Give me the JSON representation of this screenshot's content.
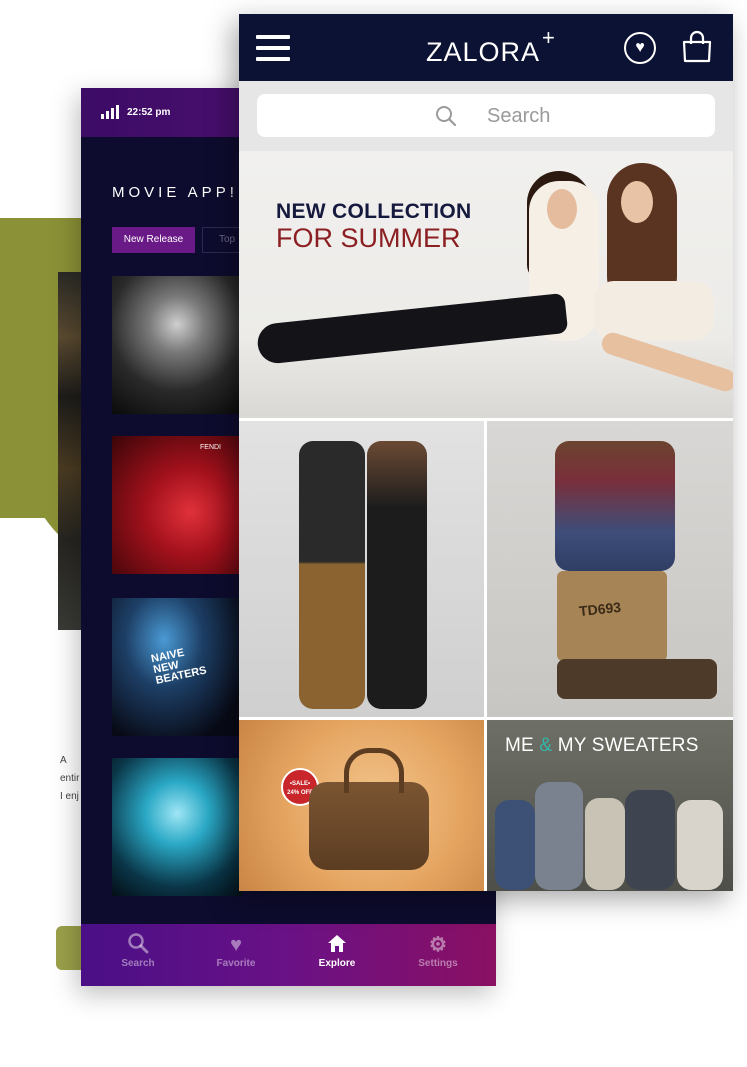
{
  "back_card": {
    "text_lines": [
      "A",
      "entir",
      "I enj"
    ]
  },
  "movie_app": {
    "status": {
      "time": "22:52 pm"
    },
    "title": "MOVIE APP!",
    "tabs": [
      {
        "label": "New Release",
        "active": true
      },
      {
        "label": "Top",
        "active": false
      }
    ],
    "poster_texts": {
      "band": "NAIVE NEW BEATERS",
      "banner": "FENDI"
    },
    "bottom_nav": [
      {
        "label": "Search",
        "icon": "search-icon",
        "active": false
      },
      {
        "label": "Favorite",
        "icon": "heart-icon",
        "active": false
      },
      {
        "label": "Explore",
        "icon": "home-icon",
        "active": true
      },
      {
        "label": "Settings",
        "icon": "gear-icon",
        "active": false
      }
    ]
  },
  "zalora": {
    "logo": "ZALORA",
    "logo_plus": "+",
    "search": {
      "placeholder": "Search"
    },
    "hero": {
      "line1": "NEW COLLECTION",
      "line2": "FOR SUMMER"
    },
    "bag_tile": {
      "sale_label": "•SALE•",
      "discount": "24% OFF"
    },
    "sweater_tile": {
      "title_part1": "ME",
      "amp": "&",
      "title_part2": "MY SWEATERS"
    },
    "crate_text": "TD693"
  },
  "colors": {
    "zalora_header": "#0c1233",
    "movie_bg": "#0e0c2e",
    "movie_accent": "#6a1a86",
    "olive": "#8b9136",
    "hero_red": "#8b1f22",
    "hero_navy": "#16193e"
  }
}
